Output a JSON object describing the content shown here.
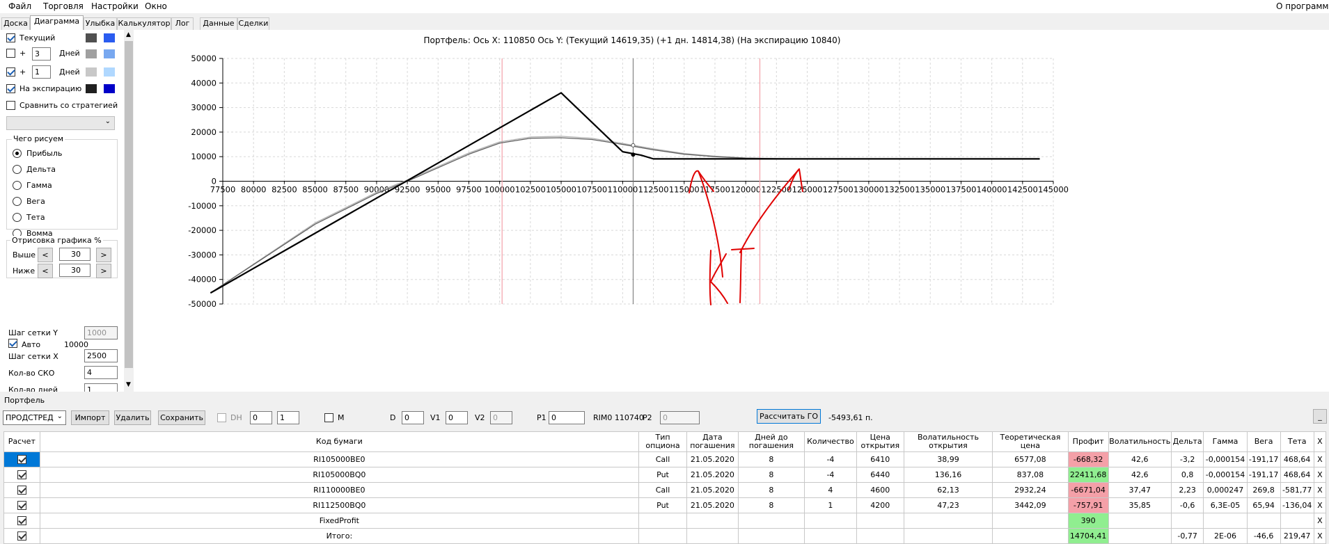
{
  "menu": {
    "file": "Файл",
    "trade": "Торговля",
    "settings": "Настройки",
    "window": "Окно",
    "about": "О программе"
  },
  "tabs": [
    "Доска",
    "Диаграмма",
    "Улыбка",
    "Калькулятор",
    "Лог",
    "Данные",
    "Сделки"
  ],
  "left": {
    "current_label": "Текущий",
    "plus": "+",
    "days_label": "Дней",
    "row1_days": "3",
    "row2_days": "1",
    "expiration_label": "На экспирацию",
    "compare_label": "Сравнить со стратегией",
    "what_group": "Чего рисуем",
    "radios": [
      "Прибыль",
      "Дельта",
      "Гамма",
      "Вега",
      "Тета",
      "Вомма"
    ],
    "draw_group": "Отрисовка графика %",
    "above_label": "Выше",
    "above_value": "30",
    "below_label": "Ниже",
    "below_value": "30",
    "prev": "<",
    "next": ">",
    "grid_y_label": "Шаг сетки Y",
    "grid_y_value": "1000",
    "auto_label": "Авто",
    "auto_value": "10000",
    "grid_x_label": "Шаг сетки X",
    "grid_x_value": "2500",
    "sko_label": "Кол-во СКО",
    "sko_value": "4",
    "days_count_label": "Кол-во дней",
    "days_count_value": "1"
  },
  "chart_header": "Портфель:  Ось X:  110850  Ось Y:  (Текущий  14619,35)  (+1 дн.  14814,38)  (На экспирацию  10840)",
  "annotation": "KT",
  "chart_data": {
    "type": "line",
    "xlim": [
      77500,
      145000
    ],
    "ylim": [
      -50000,
      50000
    ],
    "x_ticks": [
      77500,
      80000,
      82500,
      85000,
      87500,
      90000,
      92500,
      95000,
      97500,
      100000,
      102500,
      105000,
      107500,
      110000,
      112500,
      115000,
      117500,
      120000,
      122500,
      125000,
      127500,
      130000,
      132500,
      135000,
      137500,
      140000,
      142500,
      145000
    ],
    "y_ticks": [
      50000,
      40000,
      30000,
      20000,
      10000,
      0,
      -10000,
      -20000,
      -30000,
      -40000,
      -50000
    ],
    "grid": true,
    "vertical_markers": {
      "cursor_x": 110850,
      "pink_lines": [
        100200,
        121150
      ]
    },
    "series": [
      {
        "name": "На экспирацию",
        "color": "#000000",
        "x": [
          76500,
          105000,
          110000,
          111500,
          112500,
          115000,
          120000,
          125000,
          130000,
          135000,
          140000,
          143900
        ],
        "y": [
          -45500,
          36000,
          12000,
          10600,
          9100,
          9100,
          9100,
          9100,
          9100,
          9100,
          9100,
          9100
        ]
      },
      {
        "name": "Текущий",
        "color": "#606060",
        "x": [
          76500,
          85000,
          90000,
          92500,
          95000,
          97500,
          100000,
          102500,
          105000,
          107500,
          110000,
          112500,
          115000,
          117500,
          120000,
          122500,
          125000
        ],
        "y": [
          -45500,
          -17500,
          -5000,
          0,
          5500,
          11000,
          15500,
          17500,
          17700,
          17000,
          15000,
          12800,
          11000,
          10000,
          9400,
          9200,
          9100
        ]
      },
      {
        "name": "+1 дн.",
        "color": "#b0b0b0",
        "x": [
          76500,
          85000,
          90000,
          92500,
          95000,
          97500,
          100000,
          102500,
          105000,
          107500,
          110000,
          112500,
          115000,
          117500,
          120000,
          122500,
          125000
        ],
        "y": [
          -45500,
          -17000,
          -4500,
          500,
          6000,
          11500,
          16000,
          18000,
          18300,
          17500,
          15400,
          13200,
          11300,
          10200,
          9500,
          9200,
          9100
        ]
      }
    ]
  },
  "toolbar": {
    "portfolio_label": "Портфель",
    "strategy": "ПРОДСТРЕД",
    "import": "Импорт",
    "delete": "Удалить",
    "save": "Сохранить",
    "dh": "DH",
    "dh_v1": "0",
    "dh_v2": "1",
    "m": "M",
    "d_label": "D",
    "d_value": "0",
    "v1_label": "V1",
    "v1_value": "0",
    "v2_label": "V2",
    "v2_value": "0",
    "p1_label": "P1",
    "p1_value": "0",
    "rim": "RIM0 110740",
    "p2_label": "P2",
    "p2_value": "0",
    "calc_go": "Рассчитать ГО",
    "go_value": "-5493,61 п.",
    "min": "_"
  },
  "table": {
    "headers": [
      "Расчет",
      "Код бумаги",
      "Тип опциона",
      "Дата погашения",
      "Дней до погашения",
      "Количество",
      "Цена открытия",
      "Волатильность открытия",
      "Теоретическая цена",
      "Профит",
      "Волатильность",
      "Дельта",
      "Гамма",
      "Вега",
      "Тета",
      "X"
    ],
    "rows": [
      {
        "code": "RI105000BE0",
        "type": "Call",
        "date": "21.05.2020",
        "days": "8",
        "qty": "-4",
        "open": "6410",
        "vol_open": "38,99",
        "theo": "6577,08",
        "profit": "-668,32",
        "profit_sign": "neg",
        "vol": "42,6",
        "delta": "-3,2",
        "gamma": "-0,000154",
        "vega": "-191,17",
        "theta": "468,64",
        "x": "X"
      },
      {
        "code": "RI105000BQ0",
        "type": "Put",
        "date": "21.05.2020",
        "days": "8",
        "qty": "-4",
        "open": "6440",
        "vol_open": "136,16",
        "theo": "837,08",
        "profit": "22411,68",
        "profit_sign": "pos",
        "vol": "42,6",
        "delta": "0,8",
        "gamma": "-0,000154",
        "vega": "-191,17",
        "theta": "468,64",
        "x": "X"
      },
      {
        "code": "RI110000BE0",
        "type": "Call",
        "date": "21.05.2020",
        "days": "8",
        "qty": "4",
        "open": "4600",
        "vol_open": "62,13",
        "theo": "2932,24",
        "profit": "-6671,04",
        "profit_sign": "neg",
        "vol": "37,47",
        "delta": "2,23",
        "gamma": "0,000247",
        "vega": "269,8",
        "theta": "-581,77",
        "x": "X"
      },
      {
        "code": "RI112500BQ0",
        "type": "Put",
        "date": "21.05.2020",
        "days": "8",
        "qty": "1",
        "open": "4200",
        "vol_open": "47,23",
        "theo": "3442,09",
        "profit": "-757,91",
        "profit_sign": "neg",
        "vol": "35,85",
        "delta": "-0,6",
        "gamma": "6,3E-05",
        "vega": "65,94",
        "theta": "-136,04",
        "x": "X"
      },
      {
        "code": "FixedProfit",
        "type": "",
        "date": "",
        "days": "",
        "qty": "",
        "open": "",
        "vol_open": "",
        "theo": "",
        "profit": "390",
        "profit_sign": "pos",
        "vol": "",
        "delta": "",
        "gamma": "",
        "vega": "",
        "theta": "",
        "x": "X"
      },
      {
        "code": "Итого:",
        "type": "",
        "date": "",
        "days": "",
        "qty": "",
        "open": "",
        "vol_open": "",
        "theo": "",
        "profit": "14704,41",
        "profit_sign": "pos",
        "vol": "",
        "delta": "-0,77",
        "gamma": "2E-06",
        "vega": "-46,6",
        "theta": "219,47",
        "x": "X"
      }
    ]
  },
  "colors": {
    "swatch_dark": "#505050",
    "swatch_blue": "#2a5cf0",
    "swatch_gray": "#a0a0a0",
    "swatch_lightblue": "#78a8f0",
    "swatch_lgray": "#c8c8c8",
    "swatch_paleblue": "#b0d8ff",
    "swatch_black": "#202020",
    "swatch_navy": "#0000c8",
    "profit_pos": "#90ee90",
    "profit_neg": "#f4a0a8",
    "annotation": "#e00000"
  }
}
